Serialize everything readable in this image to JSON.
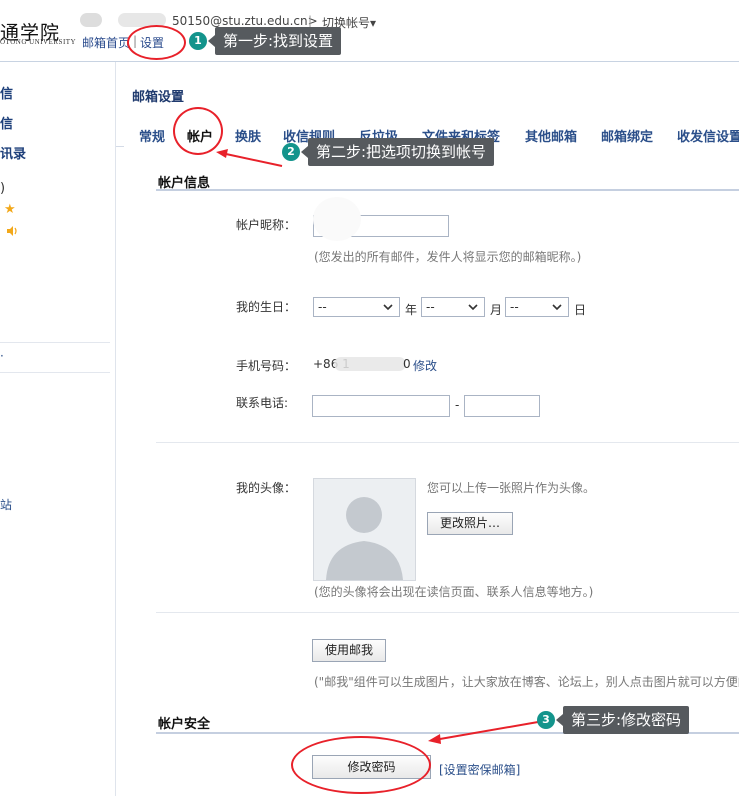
{
  "header": {
    "logo_text": "通学院",
    "logo_sub": "OTONG UNIVERSITY",
    "email_text": "50150@stu.ztu.edu.cn>",
    "switch_label": "切换帐号▾",
    "nav_home": "邮箱首页",
    "nav_settings": "设置"
  },
  "sidebar": {
    "items": [
      "信",
      "信",
      "讯录",
      ")",
      "站"
    ]
  },
  "main": {
    "title": "邮箱设置",
    "tabs": [
      "常规",
      "帐户",
      "换肤",
      "收信规则",
      "反垃圾",
      "文件夹和标签",
      "其他邮箱",
      "邮箱绑定",
      "收发信设置"
    ],
    "active_tab": "帐户"
  },
  "account_info": {
    "section_title": "帐户信息",
    "nickname_label": "帐户昵称：",
    "nickname_hint": "(您发出的所有邮件，发件人将显示您的邮箱昵称。)",
    "birthday_label": "我的生日：",
    "birthday_placeholder": "--",
    "year_unit": "年",
    "month_unit": "月",
    "day_unit": "日",
    "mobile_label": "手机号码：",
    "mobile_prefix": "+86 1",
    "mobile_suffix": "0",
    "mobile_edit": "修改",
    "phone_label": "联系电话:",
    "phone_dash": "-",
    "avatar_label": "我的头像：",
    "avatar_upload_hint": "您可以上传一张照片作为头像。",
    "change_photo_button": "更改照片…",
    "avatar_hint": "(您的头像将会出现在读信页面、联系人信息等地方。)",
    "use_mailme_button": "使用邮我",
    "mailme_hint": "(\"邮我\"组件可以生成图片，让大家放在博客、论坛上，别人点击图片就可以方便的"
  },
  "account_security": {
    "section_title": "帐户安全",
    "change_password_button": "修改密码",
    "security_email_link": "[设置密保邮箱]"
  },
  "annotations": {
    "step1_num": "1",
    "step1_text": "第一步:找到设置",
    "step2_num": "2",
    "step2_text": "第二步:把选项切换到帐号",
    "step3_num": "3",
    "step3_text": "第三步:修改密码"
  },
  "colors": {
    "accent_blue": "#2b4f8a",
    "annotation_red": "#e8212a",
    "badge_teal": "#13948c",
    "callout_gray": "#565a5e"
  }
}
